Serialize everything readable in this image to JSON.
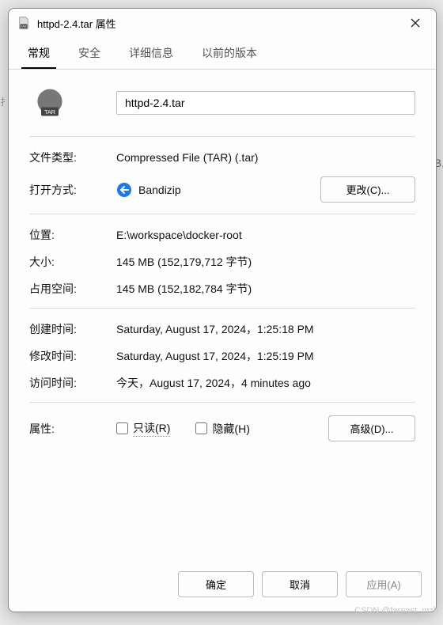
{
  "window": {
    "title": "httpd-2.4.tar 属性"
  },
  "tabs": {
    "general": "常规",
    "security": "安全",
    "details": "详细信息",
    "previous": "以前的版本"
  },
  "general": {
    "filename": "httpd-2.4.tar",
    "filetype_label": "文件类型:",
    "filetype_value": "Compressed File (TAR) (.tar)",
    "openwith_label": "打开方式:",
    "openwith_app": "Bandizip",
    "change_btn": "更改(C)...",
    "location_label": "位置:",
    "location_value": "E:\\workspace\\docker-root",
    "size_label": "大小:",
    "size_value": "145 MB (152,179,712 字节)",
    "ondisk_label": "占用空间:",
    "ondisk_value": "145 MB (152,182,784 字节)",
    "created_label": "创建时间:",
    "created_value": "Saturday, August 17, 2024，1:25:18 PM",
    "modified_label": "修改时间:",
    "modified_value": "Saturday, August 17, 2024，1:25:19 PM",
    "accessed_label": "访问时间:",
    "accessed_value": "今天，August 17, 2024，4 minutes ago",
    "attrib_label": "属性:",
    "readonly_label": "只读(R)",
    "hidden_label": "隐藏(H)",
    "advanced_btn": "高级(D)..."
  },
  "footer": {
    "ok": "确定",
    "cancel": "取消",
    "apply": "应用(A)"
  },
  "behind": {
    "left": "扌",
    "right": "B,"
  },
  "watermark": "CSDN @fareast_mzh"
}
